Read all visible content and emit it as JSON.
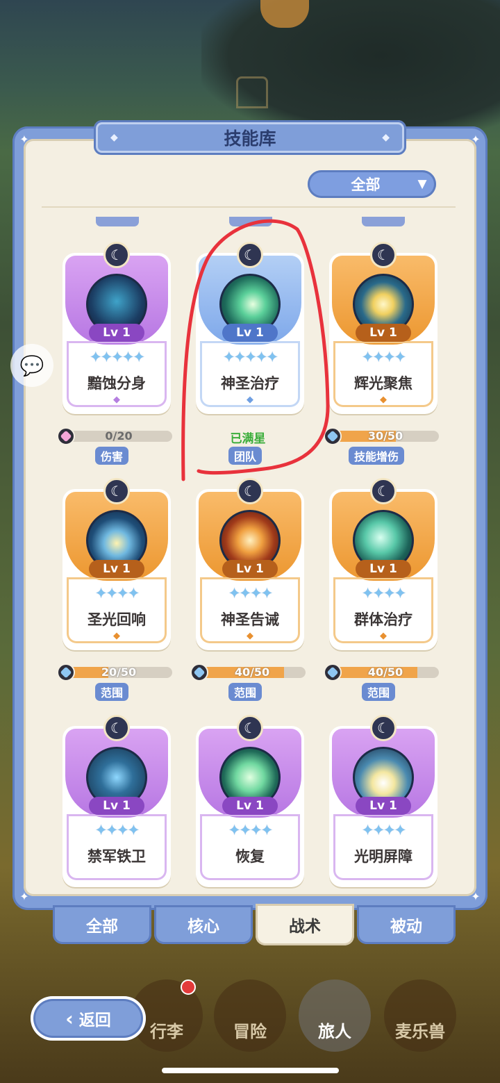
{
  "panel": {
    "title": "技能库"
  },
  "filter": {
    "label": "全部",
    "arrow": "▼"
  },
  "cards": [
    {
      "name": "黯蚀分身",
      "level": "Lv 1",
      "stars": "✦✦✦✦✦",
      "color": "purple",
      "progress_text": "0/20",
      "progress": 0.0,
      "tag": "伤害",
      "gem": "pink"
    },
    {
      "name": "神圣治疗",
      "level": "Lv 1",
      "stars": "✦✦✦✦✦",
      "color": "blue",
      "status": "已满星",
      "tag": "团队"
    },
    {
      "name": "辉光聚焦",
      "level": "Lv 1",
      "stars": "✦✦✦✦",
      "color": "orange",
      "progress_text": "30/50",
      "progress": 0.6,
      "tag": "技能增伤",
      "gem": "blue"
    },
    {
      "name": "圣光回响",
      "level": "Lv 1",
      "stars": "✦✦✦✦",
      "color": "orange",
      "progress_text": "20/50",
      "progress": 0.4,
      "tag": "范围",
      "gem": "blue"
    },
    {
      "name": "神圣告诫",
      "level": "Lv 1",
      "stars": "✦✦✦✦",
      "color": "orange",
      "progress_text": "40/50",
      "progress": 0.8,
      "tag": "范围",
      "gem": "blue"
    },
    {
      "name": "群体治疗",
      "level": "Lv 1",
      "stars": "✦✦✦✦",
      "color": "orange",
      "progress_text": "40/50",
      "progress": 0.8,
      "tag": "范围",
      "gem": "blue"
    },
    {
      "name": "禁军铁卫",
      "level": "Lv 1",
      "stars": "✦✦✦✦",
      "color": "purple"
    },
    {
      "name": "恢复",
      "level": "Lv 1",
      "stars": "✦✦✦✦",
      "color": "purple"
    },
    {
      "name": "光明屏障",
      "level": "Lv 1",
      "stars": "✦✦✦✦",
      "color": "purple"
    }
  ],
  "tabs": [
    "全部",
    "核心",
    "战术",
    "被动"
  ],
  "active_tab": "战术",
  "back": {
    "label": "返回"
  },
  "nav": [
    "行李",
    "冒险",
    "旅人",
    "麦乐兽"
  ],
  "active_nav": "旅人",
  "colors": {
    "panel_blue": "#7f9ed9",
    "purple_card": "#b777e3",
    "orange_card": "#ec9730",
    "blue_card": "#7ea8ea",
    "annotation_red": "#e8323c",
    "maxed_green": "#3cae3c"
  }
}
